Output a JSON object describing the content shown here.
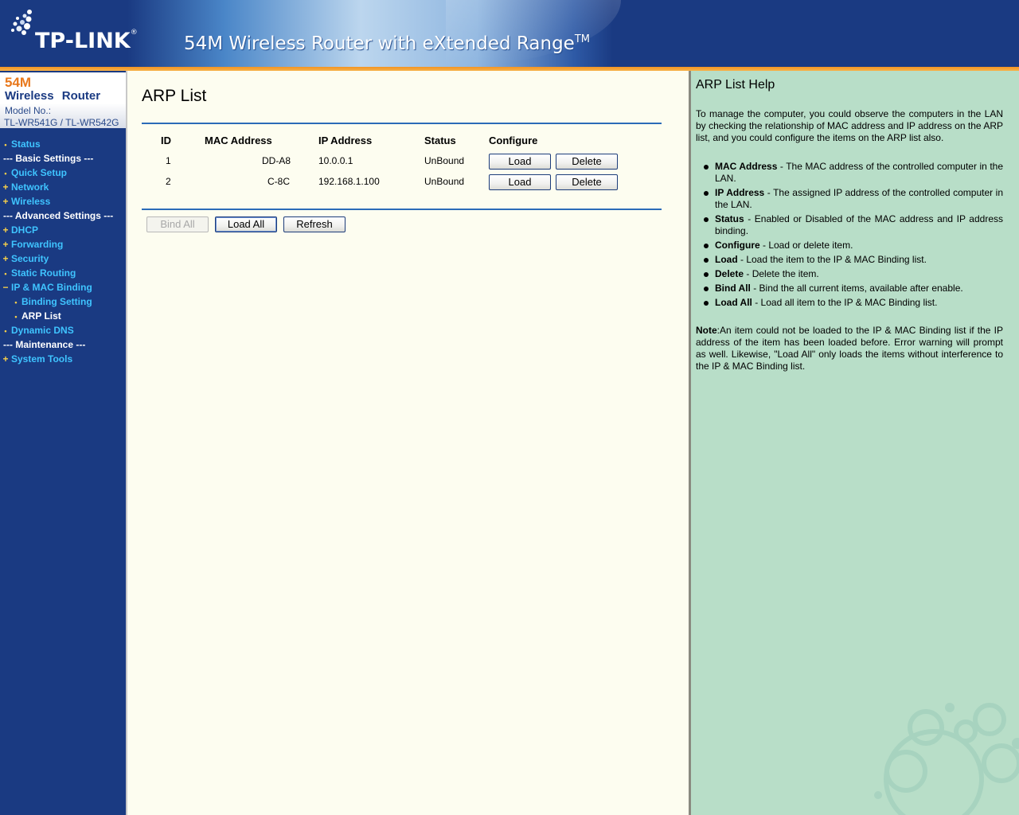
{
  "header": {
    "brand": "TP-LINK",
    "brand_mark": "®",
    "product": "54M Wireless Router with eXtended Range",
    "product_tm": "TM"
  },
  "model": {
    "line1": "54M",
    "line2": "Wireless Router",
    "line3": "Model No.:",
    "line4": "TL-WR541G / TL-WR542G"
  },
  "menu": [
    {
      "label": "Status",
      "bullet": "•"
    },
    {
      "label": "--- Basic Settings ---",
      "bullet": ""
    },
    {
      "label": "Quick Setup",
      "bullet": "•"
    },
    {
      "label": "Network",
      "bullet": "+"
    },
    {
      "label": "Wireless",
      "bullet": "+"
    },
    {
      "label": "--- Advanced Settings ---",
      "bullet": ""
    },
    {
      "label": "DHCP",
      "bullet": "+"
    },
    {
      "label": "Forwarding",
      "bullet": "+"
    },
    {
      "label": "Security",
      "bullet": "+"
    },
    {
      "label": "Static Routing",
      "bullet": "•"
    },
    {
      "label": "IP & MAC Binding",
      "bullet": "−"
    },
    {
      "label": "Binding Setting",
      "bullet": "•"
    },
    {
      "label": "ARP List",
      "bullet": "•"
    },
    {
      "label": "Dynamic DNS",
      "bullet": "•"
    },
    {
      "label": "--- Maintenance ---",
      "bullet": ""
    },
    {
      "label": "System Tools",
      "bullet": "+"
    }
  ],
  "page": {
    "title": "ARP List",
    "columns": [
      "ID",
      "MAC Address",
      "IP Address",
      "Status",
      "Configure"
    ],
    "rows": [
      {
        "id": "1",
        "mac": "DD-A8",
        "ip": "10.0.0.1",
        "status": "UnBound",
        "load": "Load",
        "delete": "Delete"
      },
      {
        "id": "2",
        "mac": "C-8C",
        "ip": "192.168.1.100",
        "status": "UnBound",
        "load": "Load",
        "delete": "Delete"
      }
    ],
    "bind_all": "Bind All",
    "load_all": "Load All",
    "refresh": "Refresh"
  },
  "help": {
    "title": "ARP List Help",
    "intro": "To manage the computer, you could observe the computers in the LAN by checking the relationship of MAC address and IP address on the ARP list, and you could configure the items on the ARP list also.",
    "items": [
      {
        "term": "MAC Address",
        "desc": " - The MAC address of the controlled computer in the LAN."
      },
      {
        "term": "IP Address",
        "desc": " - The assigned IP address of the controlled computer in the LAN."
      },
      {
        "term": "Status",
        "desc": " - Enabled or Disabled of the MAC address and IP address binding."
      },
      {
        "term": "Configure",
        "desc": " - Load or delete item."
      },
      {
        "term": "Load",
        "desc": " - Load the item to the IP & MAC Binding list."
      },
      {
        "term": "Delete",
        "desc": " - Delete the item."
      },
      {
        "term": "Bind All",
        "desc": " - Bind the all current items, available after enable."
      },
      {
        "term": "Load All",
        "desc": " - Load all item to the IP & MAC Binding list."
      }
    ],
    "note_label": "Note",
    "note_text": ":An item could not be loaded to the IP & MAC Binding list if the IP address of the item has been loaded before. Error warning will prompt as well. Likewise, \"Load All\" only loads the items without interference to the IP & MAC Binding list."
  },
  "colors": {
    "nav_bg": "#1a3a82",
    "nav_link": "#3fc4ff",
    "accent_orange": "#f39422",
    "rule_blue": "#2b6bb8",
    "main_bg": "#fdfdf0",
    "help_bg": "#b8dec8"
  },
  "icons": {
    "logo": "tp-link-dots-icon",
    "bullet": "dot-bullet-icon",
    "expand": "plus-icon",
    "collapse": "minus-icon"
  }
}
